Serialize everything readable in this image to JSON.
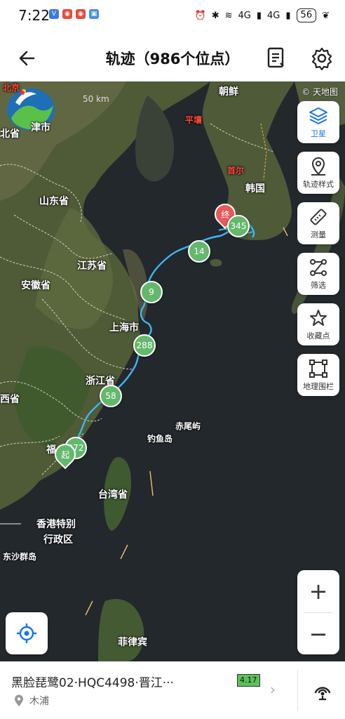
{
  "status": {
    "time": "7:22",
    "network_1": "4G",
    "network_2": "4G",
    "battery": "56"
  },
  "header": {
    "title": "轨迹（986个位点）"
  },
  "map": {
    "scale_label": "50 km",
    "credit": "© 天地图",
    "labels": {
      "beijing": "北京",
      "tianjin": "津市",
      "hebei": "北省",
      "shandong": "山东省",
      "jiangsu": "江苏省",
      "anhui": "安徽省",
      "shanghai": "上海市",
      "zhejiang": "浙江省",
      "jiangxi": "西省",
      "fujian": "福",
      "taiwan": "台湾省",
      "hongkong_1": "香港特别",
      "hongkong_2": "行政区",
      "dongsha": "东沙群岛",
      "chosun": "朝鲜",
      "pyongyang": "平壤",
      "seoul": "首尔",
      "korea": "韩国",
      "chiwei": "赤尾屿",
      "diaoyu": "钓鱼岛",
      "philippines": "菲律宾"
    },
    "markers": {
      "start": "起",
      "end": "终",
      "clusters": [
        "345",
        "14",
        "9",
        "288",
        "58",
        "372"
      ]
    }
  },
  "tools": [
    {
      "label": "卫星",
      "icon": "layers-icon"
    },
    {
      "label": "轨迹样式",
      "icon": "location-pin-icon"
    },
    {
      "label": "测量",
      "icon": "ruler-icon"
    },
    {
      "label": "筛选",
      "icon": "filter-path-icon"
    },
    {
      "label": "收藏点",
      "icon": "star-icon"
    },
    {
      "label": "地理围栏",
      "icon": "geofence-icon"
    }
  ],
  "zoom": {
    "in": "+",
    "out": "−"
  },
  "card": {
    "name": "黑脸琵鹭02·HQC4498·晋江···",
    "location": "木浦",
    "battery_voltage": "4.17"
  },
  "colors": {
    "track": "#3fb6f0",
    "cluster": "#63b86c",
    "end_pin": "#e85a5a",
    "start_pin": "#63b86c",
    "accent": "#1a73e8"
  }
}
